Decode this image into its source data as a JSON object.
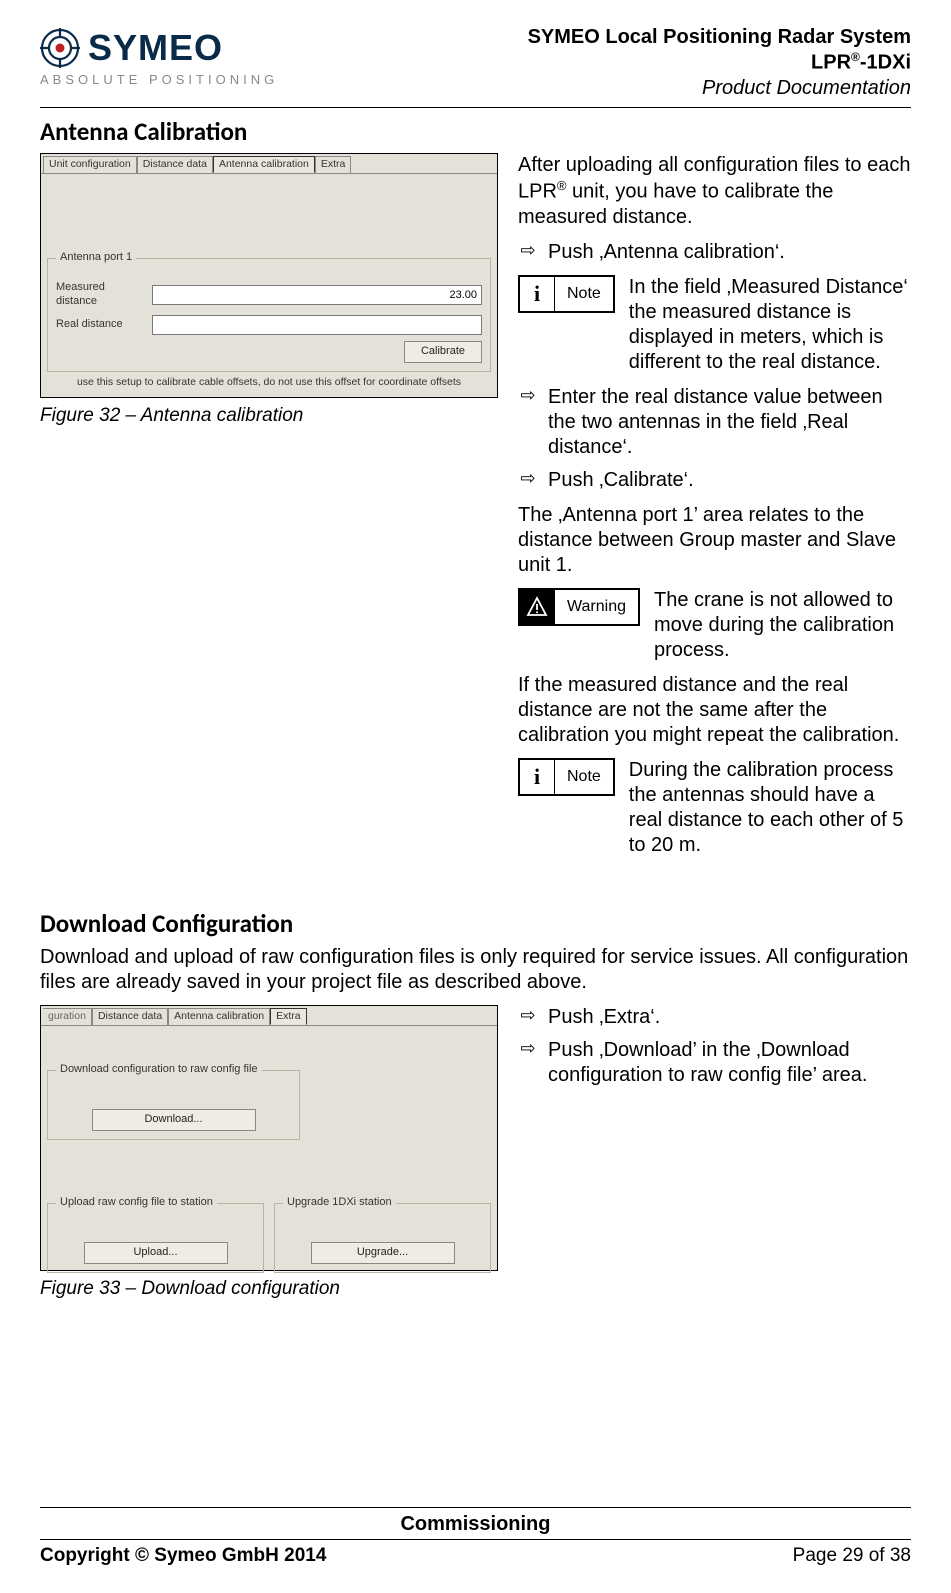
{
  "header": {
    "brand": "SYMEO",
    "brand_sub": "ABSOLUTE POSITIONING",
    "line1": "SYMEO Local Positioning Radar System",
    "line2_pre": "LPR",
    "line2_sup": "®",
    "line2_post": "-1DXi",
    "line3": "Product Documentation"
  },
  "section1": {
    "title": "Antenna Calibration",
    "figure": {
      "tabs": [
        "Unit configuration",
        "Distance data",
        "Antenna calibration",
        "Extra"
      ],
      "active_tab_index": 2,
      "group_legend": "Antenna port 1",
      "measured_label": "Measured distance",
      "measured_value": "23.00",
      "real_label": "Real distance",
      "real_value": "",
      "calibrate_btn": "Calibrate",
      "hint": "use this setup to calibrate cable offsets, do not use this offset for coordinate offsets",
      "caption": "Figure 32 – Antenna calibration"
    },
    "body": {
      "p1_a": "After uploading all configuration files to each LPR",
      "p1_sup": "®",
      "p1_b": " unit, you have to calibrate the measured distance.",
      "a1": "Push ‚Antenna calibration‘.",
      "note1_label": "Note",
      "note1_text": "In the field ‚Measured Distance‘ the measured distance is displayed in meters, which is different to the real distance.",
      "a2": "Enter the real distance value between the two antennas in the field ‚Real distance‘.",
      "a3": "Push ‚Calibrate‘.",
      "p2": "The ‚Antenna port 1’ area relates to the distance between Group master and Slave unit 1.",
      "warn_label": "Warning",
      "warn_text": "The crane is not allowed to move during the calibration process.",
      "p3": "If the measured distance and the real distance are not the same after the calibration you might repeat the calibration.",
      "note2_label": "Note",
      "note2_text": "During the calibration process the antennas should have a real distance to each other of 5 to 20 m."
    }
  },
  "section2": {
    "title": "Download Configuration",
    "intro": "Download and upload of raw configuration files is only required for service issues. All configuration files are already saved in your project file as described above.",
    "figure": {
      "tabs_trunc": "guration",
      "tabs": [
        "Distance data",
        "Antenna calibration",
        "Extra"
      ],
      "active_tab_index": 2,
      "g1_legend": "Download configuration to raw config file",
      "g1_btn": "Download...",
      "g2_legend": "Upload raw config file to station",
      "g2_btn": "Upload...",
      "g3_legend": "Upgrade 1DXi station",
      "g3_btn": "Upgrade...",
      "caption": "Figure 33 – Download configuration"
    },
    "body": {
      "a1": "Push ‚Extra‘.",
      "a2": "Push ‚Download’ in the ‚Download configuration to raw config file’ area."
    }
  },
  "footer": {
    "center": "Commissioning",
    "left": "Copyright © Symeo GmbH 2014",
    "right": "Page 29 of 38"
  }
}
